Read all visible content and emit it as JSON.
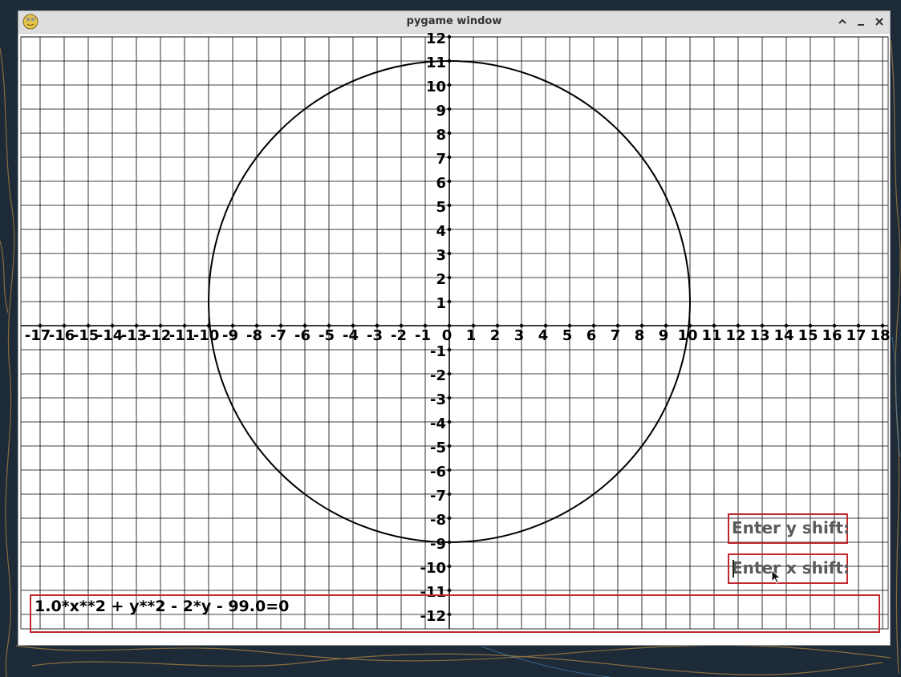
{
  "window": {
    "title": "pygame window",
    "app_icon": "pygame-snake-icon",
    "buttons": {
      "maximize_icon": "caret-up-icon",
      "minimize_icon": "minimize-icon",
      "close_icon": "close-icon"
    }
  },
  "chart_data": {
    "type": "line",
    "title": "",
    "xlabel": "",
    "ylabel": "",
    "xlim": [
      -17,
      18
    ],
    "ylim": [
      -12,
      12
    ],
    "grid": true,
    "x_ticks": [
      -17,
      -16,
      -15,
      -14,
      -13,
      -12,
      -11,
      -10,
      -9,
      -8,
      -7,
      -6,
      -5,
      -4,
      -3,
      -2,
      -1,
      0,
      1,
      2,
      3,
      4,
      5,
      6,
      7,
      8,
      9,
      10,
      11,
      12,
      13,
      14,
      15,
      16,
      17,
      18
    ],
    "y_ticks": [
      12,
      11,
      10,
      9,
      8,
      7,
      6,
      5,
      4,
      3,
      2,
      1,
      -1,
      -2,
      -3,
      -4,
      -5,
      -6,
      -7,
      -8,
      -9,
      -10,
      -11,
      -12
    ],
    "curve": {
      "shape": "circle",
      "center": [
        0,
        1
      ],
      "radius": 10,
      "color": "#000000"
    }
  },
  "inputs": {
    "y_shift_placeholder": "Enter y shift:",
    "x_shift_placeholder": "Enter x shift:",
    "equation_value": "1.0*x**2 + y**2 - 2*y - 99.0=0"
  },
  "colors": {
    "box_border": "#c0262c",
    "grid": "#000000",
    "background": "#ffffff"
  }
}
